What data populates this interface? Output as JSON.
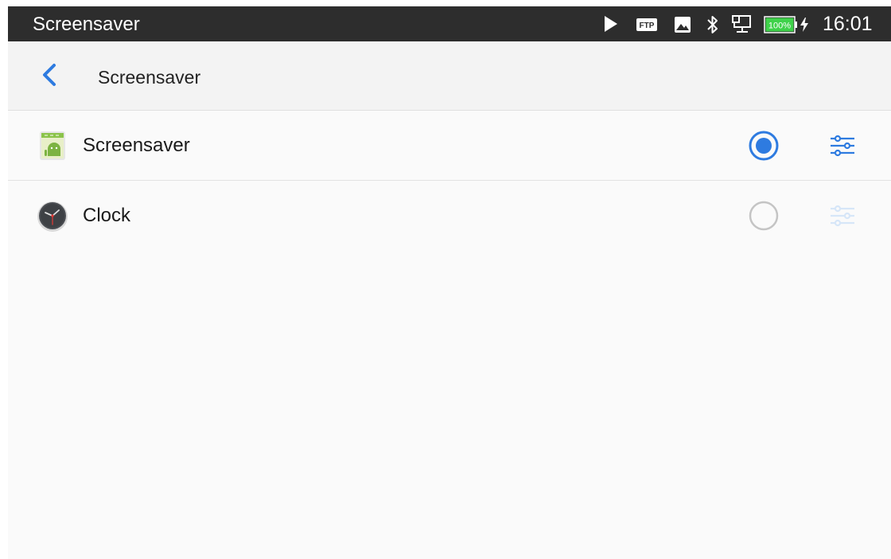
{
  "status_bar": {
    "title": "Screensaver",
    "time": "16:01",
    "battery": "100%",
    "icons": [
      "play-icon",
      "ftp-icon",
      "image-icon",
      "bluetooth-icon",
      "ethernet-icon",
      "battery-icon",
      "charging-icon"
    ],
    "ftp_label": "FTP"
  },
  "app_bar": {
    "title": "Screensaver",
    "back_icon": "chevron-left-icon"
  },
  "items": [
    {
      "label": "Screensaver",
      "icon": "android-app-icon",
      "selected": true,
      "settings_enabled": true
    },
    {
      "label": "Clock",
      "icon": "clock-app-icon",
      "selected": false,
      "settings_enabled": false
    }
  ],
  "colors": {
    "accent": "#2e7be0",
    "status_bar_bg": "#2d2d2d",
    "app_bar_bg": "#f3f3f3",
    "battery_green": "#3fd24a",
    "disabled_settings": "#d6e6f8"
  }
}
